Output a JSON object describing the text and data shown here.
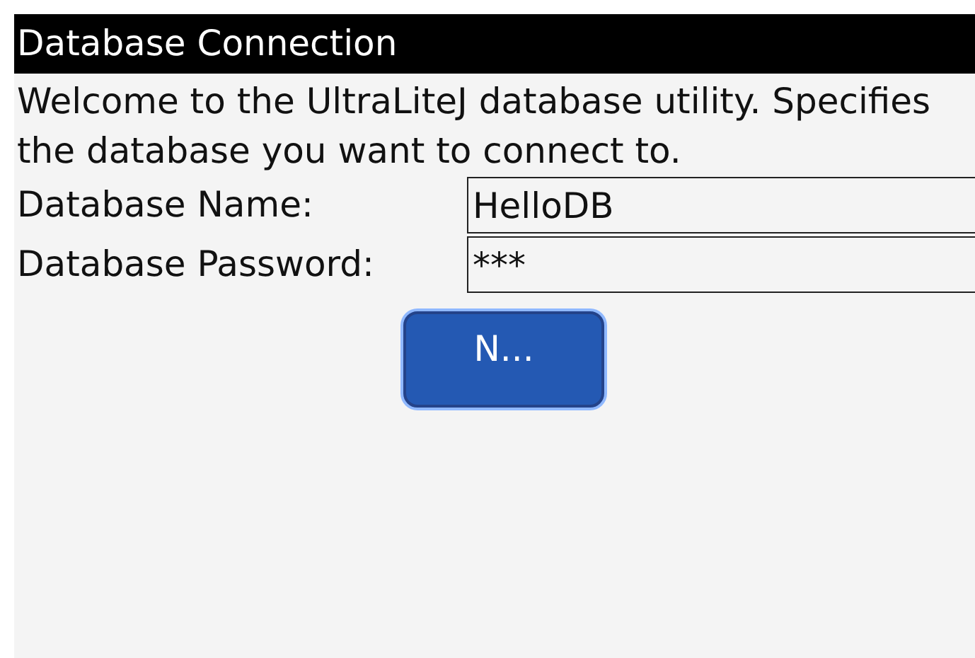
{
  "window": {
    "title": "Database Connection"
  },
  "intro": "Welcome to the UltraLiteJ database utility. Specifies the database you want to connect to.",
  "fields": [
    {
      "label": "Database Name:",
      "value": "HelloDB"
    },
    {
      "label": "Database Password:",
      "value": "***"
    }
  ],
  "button": {
    "label": "N...",
    "focused": true
  }
}
